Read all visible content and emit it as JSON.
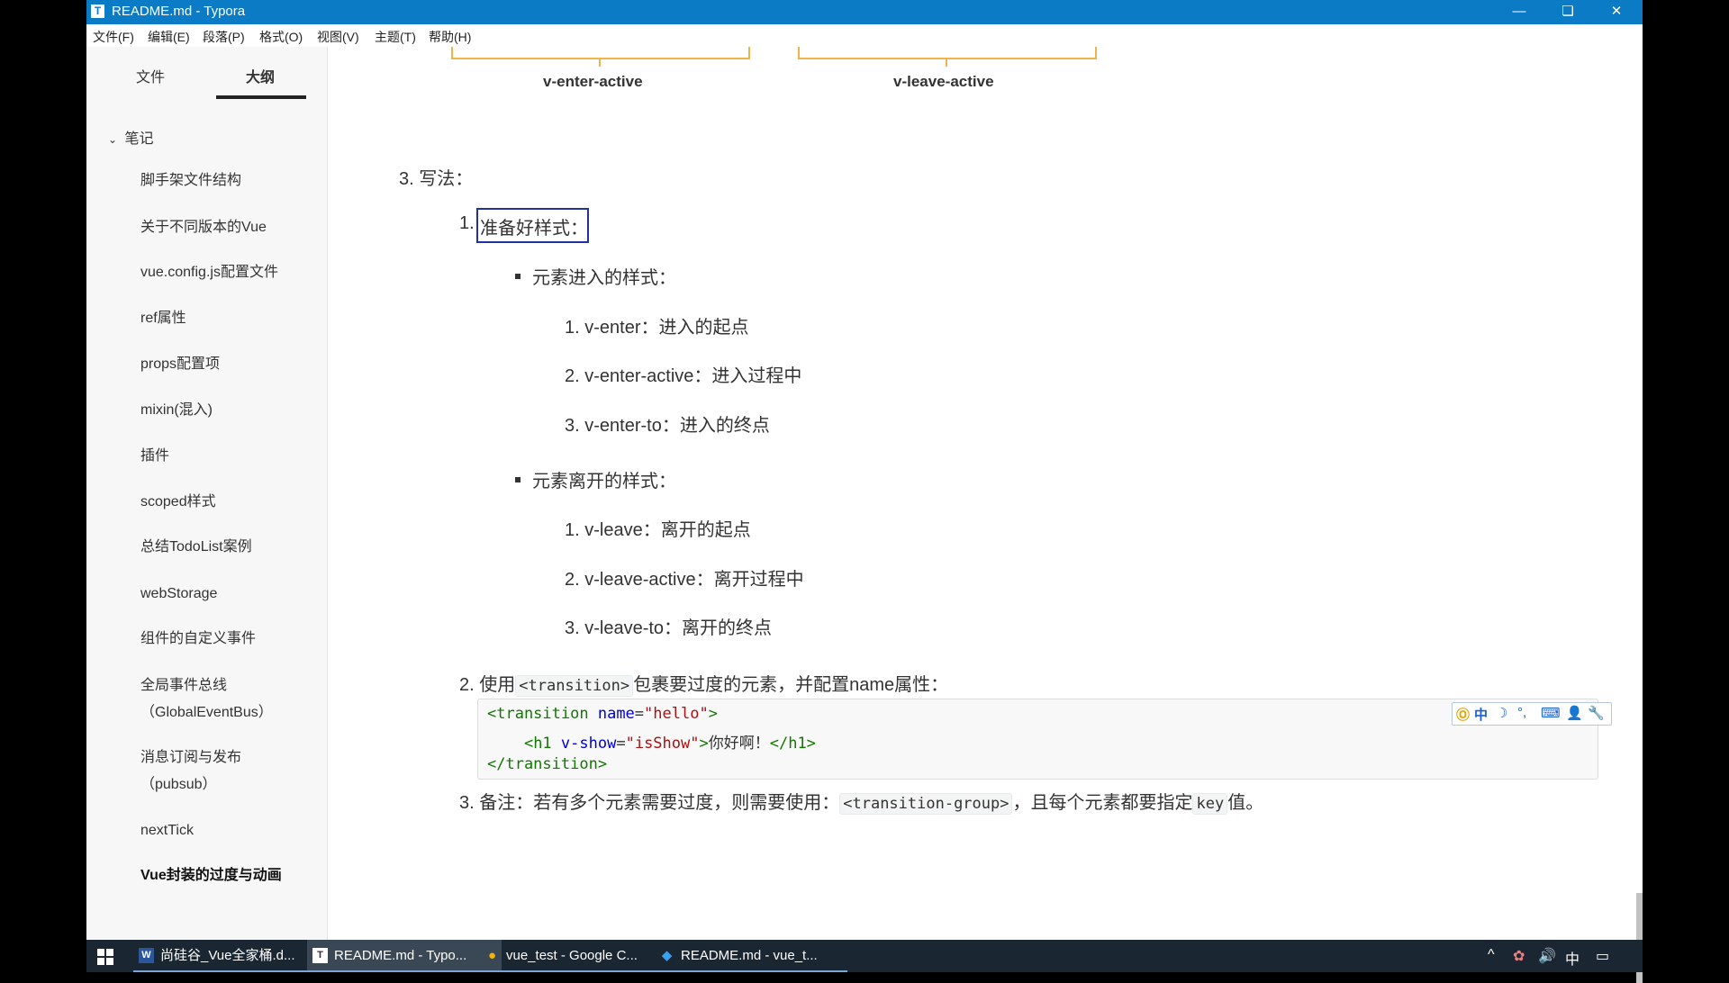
{
  "window": {
    "title": "README.md - Typora",
    "app_icon": "T"
  },
  "menu": [
    "文件(F)",
    "编辑(E)",
    "段落(P)",
    "格式(O)",
    "视图(V)",
    "主题(T)",
    "帮助(H)"
  ],
  "sidebar": {
    "tabs": [
      {
        "label": "文件"
      },
      {
        "label": "大纲"
      }
    ],
    "root": "笔记",
    "items": [
      "脚手架文件结构",
      "关于不同版本的Vue",
      "vue.config.js配置文件",
      "ref属性",
      "props配置项",
      "mixin(混入)",
      "插件",
      "scoped样式",
      "总结TodoList案例",
      "webStorage",
      "组件的自定义事件",
      "全局事件总线",
      "（GlobalEventBus）",
      "消息订阅与发布",
      "（pubsub）",
      "nextTick",
      "Vue封装的过度与动画"
    ]
  },
  "doc": {
    "diagram_labels": [
      "v-enter-active",
      "v-leave-active"
    ],
    "section3": "3. 写法：",
    "step1": {
      "num": "1.",
      "text": "准备好样式："
    },
    "enter_heading": "元素进入的样式：",
    "enter_items": [
      "1. v-enter：进入的起点",
      "2. v-enter-active：进入过程中",
      "3. v-enter-to：进入的终点"
    ],
    "leave_heading": "元素离开的样式：",
    "leave_items": [
      "1. v-leave：离开的起点",
      "2. v-leave-active：离开过程中",
      "3. v-leave-to：离开的终点"
    ],
    "step2": {
      "prefix": "2. 使用",
      "code": "<transition>",
      "suffix": "包裹要过度的元素，并配置name属性："
    },
    "code": {
      "l1_tag_open": "<transition",
      "l1_attr": "name",
      "l1_eq": "=",
      "l1_val": "\"hello\"",
      "l1_close": ">",
      "l2_tag": "<h1",
      "l2_attr": "v-show",
      "l2_eq": "=",
      "l2_val": "\"isShow\"",
      "l2_gt": ">",
      "l2_text": "你好啊！",
      "l2_end": "</h1>",
      "l3": "</transition>"
    },
    "step3": {
      "prefix": "3. 备注：若有多个元素需要过度，则需要使用：",
      "code1": "<transition-group>",
      "mid": "，且每个元素都要指定",
      "code2": "key",
      "suffix": "值。"
    },
    "ime": [
      "中",
      "☽",
      "°,",
      "⌨",
      "👤",
      "🔧"
    ]
  },
  "taskbar": {
    "items": [
      {
        "icon": "W",
        "label": "尚硅谷_Vue全家桶.d..."
      },
      {
        "icon": "T",
        "label": "README.md - Typo..."
      },
      {
        "icon": "●",
        "label": "vue_test - Google C..."
      },
      {
        "icon": "◆",
        "label": "README.md - vue_t..."
      }
    ],
    "tray": [
      "^",
      "✿",
      "🔊",
      "中",
      "▭"
    ]
  }
}
